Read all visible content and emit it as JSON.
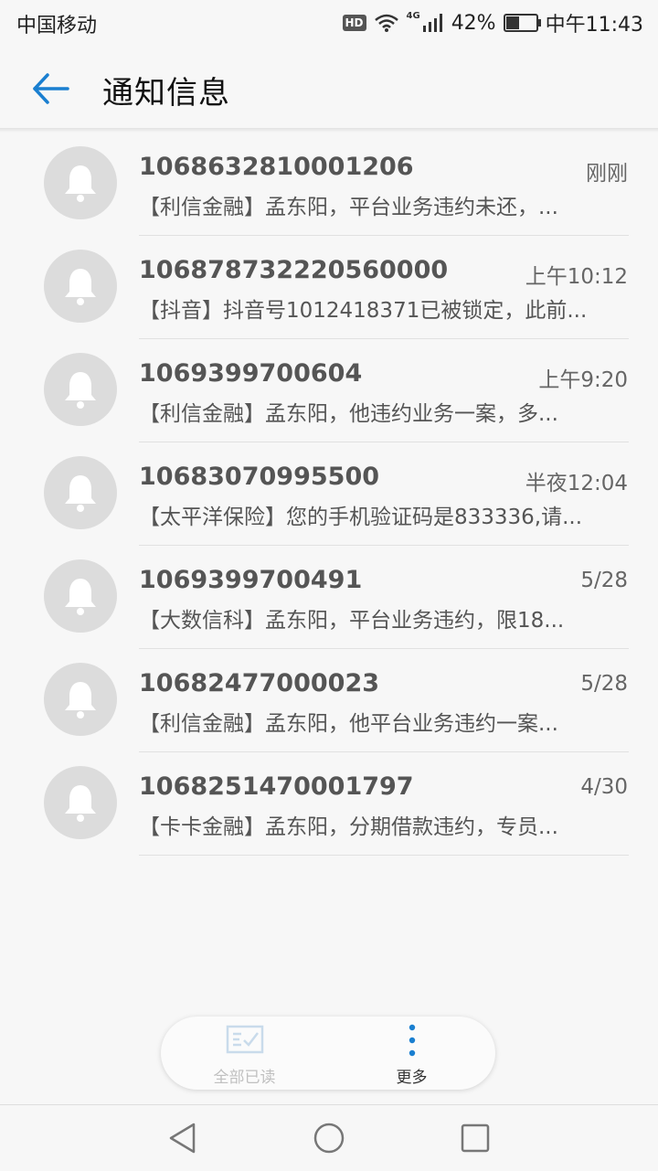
{
  "status_bar": {
    "carrier": "中国移动",
    "hd": "HD",
    "network": "4G",
    "battery_percent": "42%",
    "clock": "中午11:43",
    "battery_level": 0.42
  },
  "header": {
    "title": "通知信息",
    "back_icon": "arrow-left-icon",
    "accent_color": "#1a7fd0"
  },
  "messages": [
    {
      "sender": "1068632810001206",
      "time": "刚刚",
      "preview": "【利信金融】孟东阳，平台业务违约未还，..."
    },
    {
      "sender": "106878732220560000",
      "time": "上午10:12",
      "preview": "【抖音】抖音号1012418371已被锁定，此前..."
    },
    {
      "sender": "1069399700604",
      "time": "上午9:20",
      "preview": "【利信金融】孟东阳，他违约业务一案，多..."
    },
    {
      "sender": "10683070995500",
      "time": "半夜12:04",
      "preview": "【太平洋保险】您的手机验证码是833336,请..."
    },
    {
      "sender": "1069399700491",
      "time": "5/28",
      "preview": "【大数信科】孟东阳，平台业务违约，限18..."
    },
    {
      "sender": "10682477000023",
      "time": "5/28",
      "preview": "【利信金融】孟东阳，他平台业务违约一案..."
    },
    {
      "sender": "1068251470001797",
      "time": "4/30",
      "preview": "【卡卡金融】孟东阳，分期借款违约，专员..."
    }
  ],
  "actions": {
    "mark_all_read": "全部已读",
    "more": "更多"
  },
  "navbar": {
    "back_icon": "triangle-back-icon",
    "home_icon": "circle-home-icon",
    "recent_icon": "square-recent-icon"
  }
}
